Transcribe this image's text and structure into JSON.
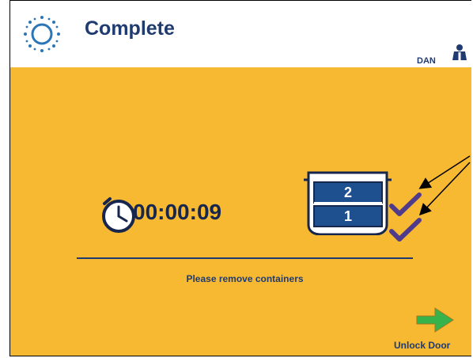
{
  "header": {
    "title": "Complete",
    "user_name": "DAN",
    "status_icon": "sun-status-icon",
    "user_icon": "person-icon"
  },
  "main": {
    "timer": "00:00:09",
    "timer_icon": "clock-icon",
    "container_labels": [
      "2",
      "1"
    ],
    "message": "Please remove containers"
  },
  "actions": {
    "unlock_label": "Unlock Door",
    "unlock_icon": "green-arrow-right-icon"
  },
  "colors": {
    "header_bg": "#ffffff",
    "content_bg": "#f7b832",
    "title_text": "#1f3b70",
    "accent_green": "#36b34a"
  }
}
